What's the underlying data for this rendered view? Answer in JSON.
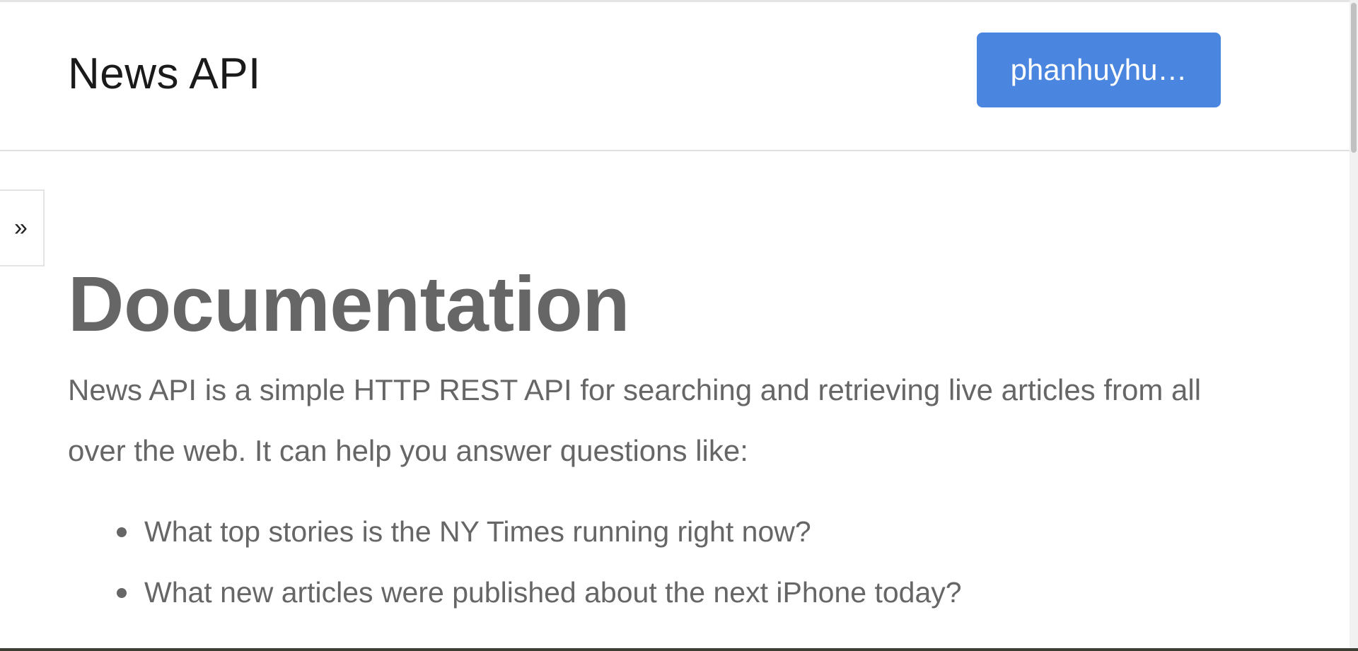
{
  "header": {
    "brand": "News API",
    "account_button_label": "phanhuyhu…"
  },
  "sidebar": {
    "toggle_label": "»"
  },
  "main": {
    "title": "Documentation",
    "intro": "News API is a simple HTTP REST API for searching and retrieving live articles from all over the web. It can help you answer questions like:",
    "questions": [
      "What top stories is the NY Times running right now?",
      "What new articles were published about the next iPhone today?"
    ]
  },
  "colors": {
    "accent": "#4a86e0",
    "text_muted": "#666666"
  }
}
